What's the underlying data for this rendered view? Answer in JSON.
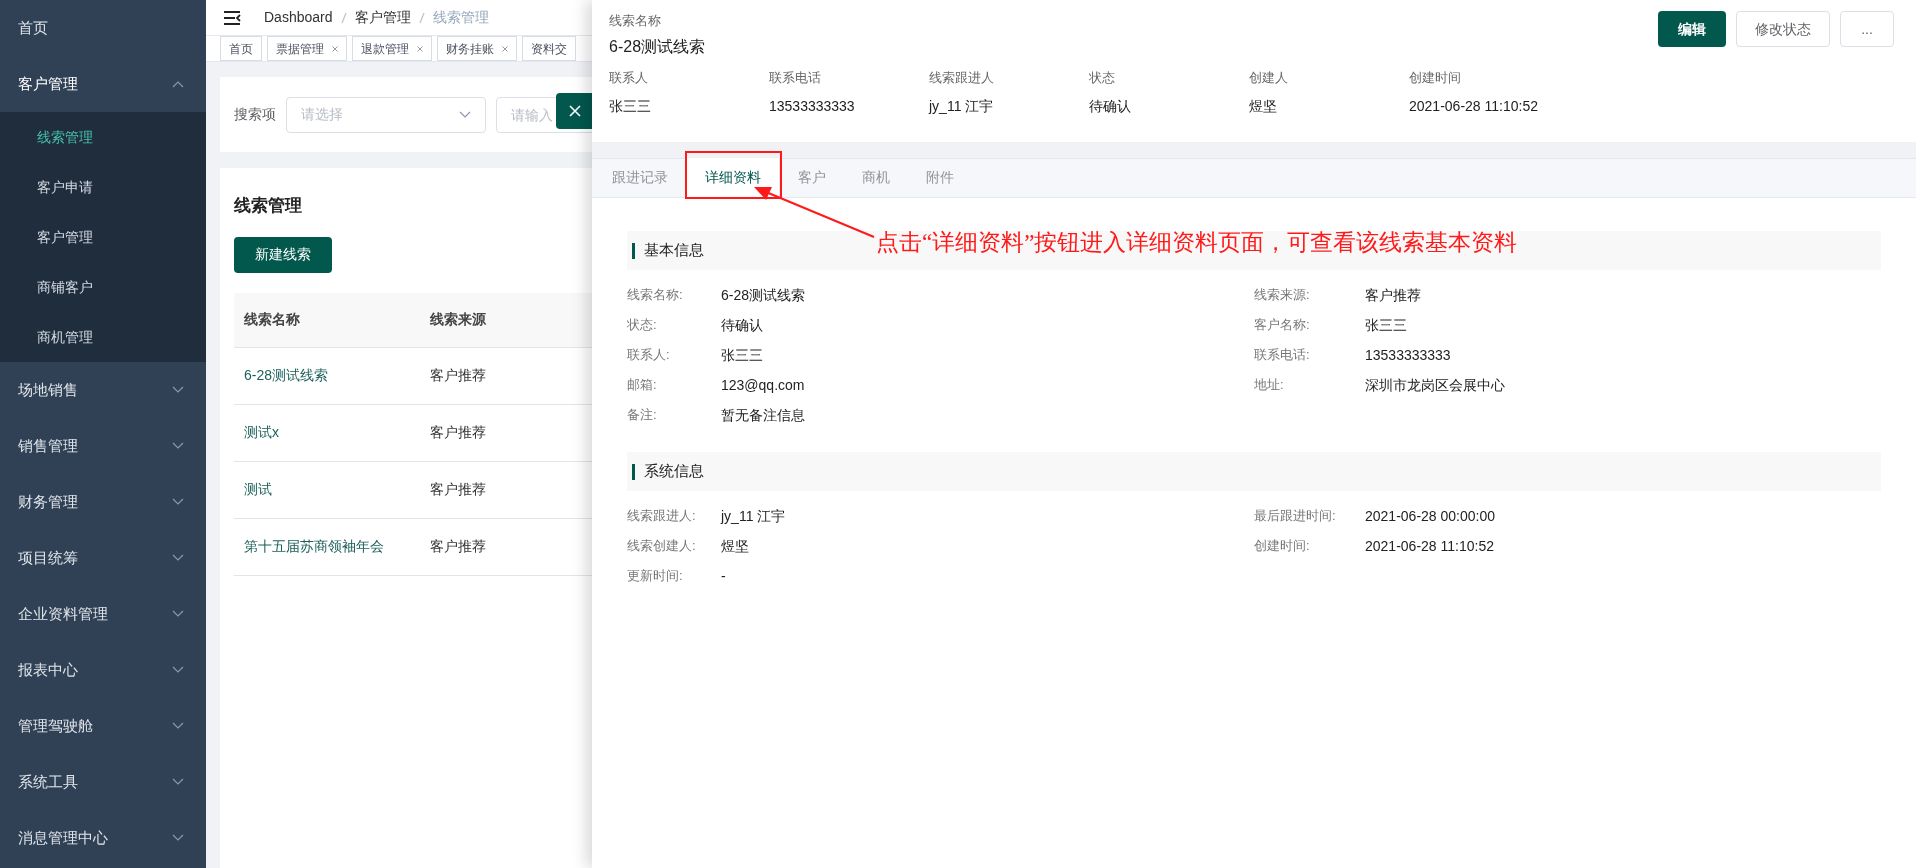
{
  "sidebar": {
    "items": [
      {
        "kind": "link",
        "label": "首页"
      },
      {
        "kind": "group",
        "label": "客户管理",
        "expanded": true,
        "children": [
          {
            "label": "线索管理",
            "selected": true
          },
          {
            "label": "客户申请",
            "selected": false
          },
          {
            "label": "客户管理",
            "selected": false
          },
          {
            "label": "商铺客户",
            "selected": false
          },
          {
            "label": "商机管理",
            "selected": false
          }
        ]
      },
      {
        "kind": "group",
        "label": "场地销售",
        "expanded": false
      },
      {
        "kind": "group",
        "label": "销售管理",
        "expanded": false
      },
      {
        "kind": "group",
        "label": "财务管理",
        "expanded": false
      },
      {
        "kind": "group",
        "label": "项目统筹",
        "expanded": false
      },
      {
        "kind": "group",
        "label": "企业资料管理",
        "expanded": false
      },
      {
        "kind": "group",
        "label": "报表中心",
        "expanded": false
      },
      {
        "kind": "group",
        "label": "管理驾驶舱",
        "expanded": false
      },
      {
        "kind": "group",
        "label": "系统工具",
        "expanded": false
      },
      {
        "kind": "group",
        "label": "消息管理中心",
        "expanded": false
      }
    ]
  },
  "breadcrumb": [
    "Dashboard",
    "客户管理",
    "线索管理"
  ],
  "tags": [
    {
      "label": "首页",
      "closable": false
    },
    {
      "label": "票据管理",
      "closable": true
    },
    {
      "label": "退款管理",
      "closable": true
    },
    {
      "label": "财务挂账",
      "closable": true
    },
    {
      "label": "资料交",
      "closable": false
    }
  ],
  "search": {
    "label": "搜索项",
    "select_placeholder": "请选择",
    "input_placeholder": "请输入"
  },
  "list": {
    "title": "线索管理",
    "new_button": "新建线索",
    "columns": [
      "线索名称",
      "线索来源"
    ],
    "rows": [
      [
        "6-28测试线索",
        "客户推荐"
      ],
      [
        "测试x",
        "客户推荐"
      ],
      [
        "测试",
        "客户推荐"
      ],
      [
        "第十五届苏商领袖年会",
        "客户推荐"
      ]
    ]
  },
  "drawer": {
    "label": "线索名称",
    "title": "6-28测试线索",
    "buttons": [
      {
        "label": "编辑",
        "kind": "primary"
      },
      {
        "label": "修改状态",
        "kind": "default"
      },
      {
        "label": "...",
        "kind": "default"
      }
    ],
    "summary": [
      {
        "label": "联系人",
        "value": "张三三"
      },
      {
        "label": "联系电话",
        "value": "13533333333"
      },
      {
        "label": "线索跟进人",
        "value": "jy_11 江宇"
      },
      {
        "label": "状态",
        "value": "待确认"
      },
      {
        "label": "创建人",
        "value": "煜坚"
      },
      {
        "label": "创建时间",
        "value": "2021-06-28 11:10:52"
      }
    ],
    "tabs": [
      {
        "label": "跟进记录",
        "selected": false
      },
      {
        "label": "详细资料",
        "selected": true
      },
      {
        "label": "客户",
        "selected": false
      },
      {
        "label": "商机",
        "selected": false
      },
      {
        "label": "附件",
        "selected": false
      }
    ],
    "sections": [
      {
        "title": "基本信息",
        "fields": [
          {
            "label": "线索名称:",
            "value": "6-28测试线索"
          },
          {
            "label": "线索来源:",
            "value": "客户推荐"
          },
          {
            "label": "状态:",
            "value": "待确认"
          },
          {
            "label": "客户名称:",
            "value": "张三三"
          },
          {
            "label": "联系人:",
            "value": "张三三"
          },
          {
            "label": "联系电话:",
            "value": "13533333333"
          },
          {
            "label": "邮箱:",
            "value": "123@qq.com"
          },
          {
            "label": "地址:",
            "value": "深圳市龙岗区会展中心"
          },
          {
            "label": "备注:",
            "value": "暂无备注信息"
          }
        ]
      },
      {
        "title": "系统信息",
        "fields": [
          {
            "label": "线索跟进人:",
            "value": "jy_11 江宇"
          },
          {
            "label": "最后跟进时间:",
            "value": "2021-06-28 00:00:00"
          },
          {
            "label": "线索创建人:",
            "value": "煜坚"
          },
          {
            "label": "创建时间:",
            "value": "2021-06-28 11:10:52"
          },
          {
            "label": "更新时间:",
            "value": "-"
          }
        ]
      }
    ]
  },
  "annotation": {
    "text": "点击“详细资料”按钮进入详细资料页面，可查看该线索基本资料"
  }
}
